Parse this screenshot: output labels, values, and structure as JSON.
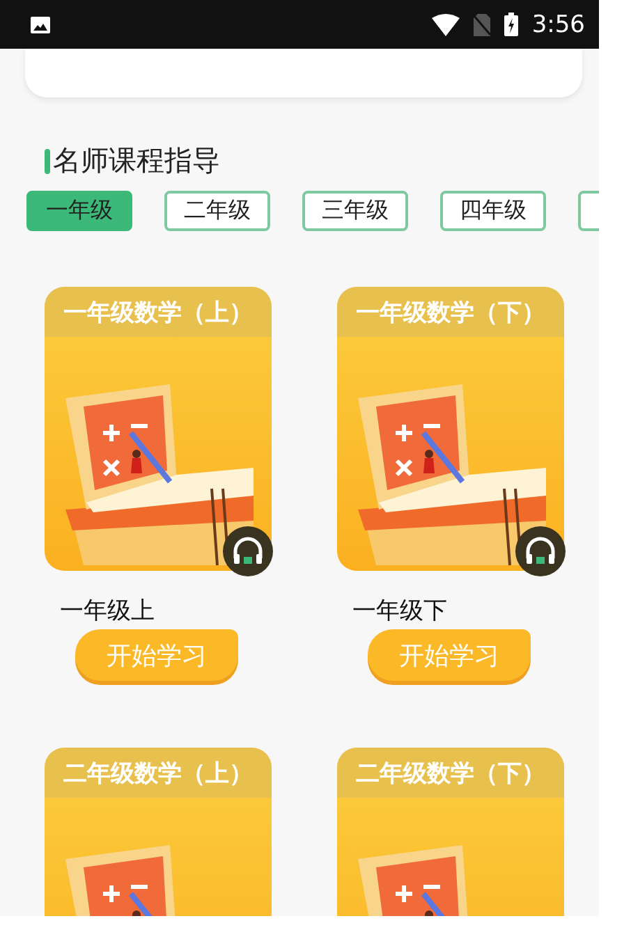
{
  "status_bar": {
    "time": "3:56"
  },
  "section": {
    "title": "名师课程指导"
  },
  "tabs": [
    {
      "label": "一年级",
      "selected": true
    },
    {
      "label": "二年级",
      "selected": false
    },
    {
      "label": "三年级",
      "selected": false
    },
    {
      "label": "四年级",
      "selected": false
    },
    {
      "selected": false
    }
  ],
  "courses": [
    {
      "cover_title": "一年级数学（上）",
      "name": "一年级上",
      "button": "开始学习"
    },
    {
      "cover_title": "一年级数学（下）",
      "name": "一年级下",
      "button": "开始学习"
    },
    {
      "cover_title": "二年级数学（上）"
    },
    {
      "cover_title": "二年级数学（下）"
    }
  ]
}
